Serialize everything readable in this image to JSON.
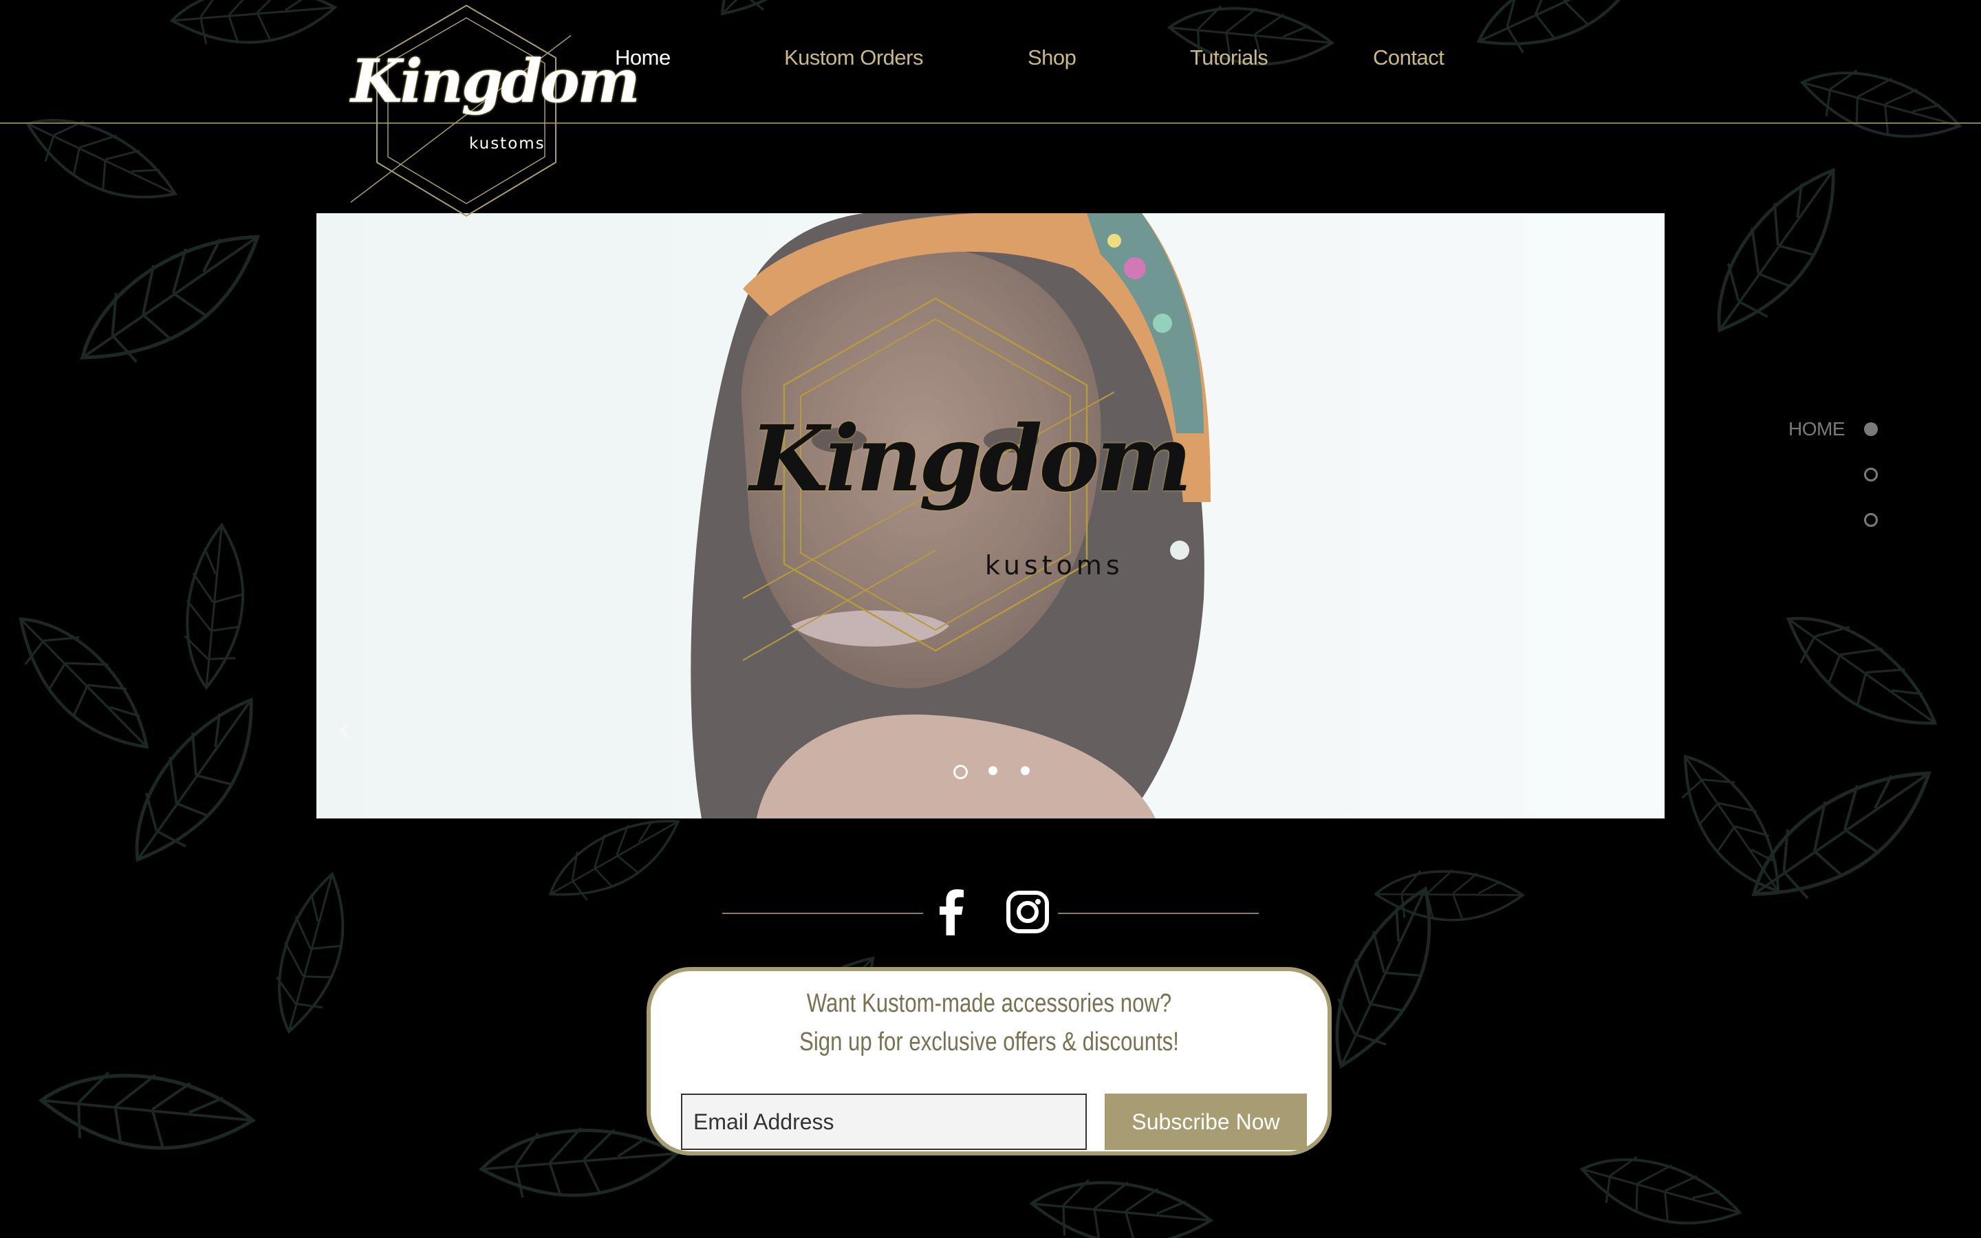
{
  "brand": {
    "name_script": "Kingdom",
    "name_sub": "kustoms",
    "accent_gold": "#a89d72",
    "background": "#000000"
  },
  "nav": {
    "items": [
      {
        "label": "Home",
        "active": true
      },
      {
        "label": "Kustom Orders",
        "active": false
      },
      {
        "label": "Shop",
        "active": false
      },
      {
        "label": "Tutorials",
        "active": false
      },
      {
        "label": "Contact",
        "active": false
      }
    ]
  },
  "slideshow": {
    "emblem_word": "Kingdom",
    "emblem_sub": "kustoms",
    "slide_count": 3,
    "current_slide": 1
  },
  "anchor_menu": {
    "label": "HOME",
    "dot_count": 3,
    "active_index": 1
  },
  "social": {
    "icons": [
      "facebook-icon",
      "instagram-icon"
    ]
  },
  "subscribe": {
    "line1": "Want Kustom-made accessories now?",
    "line2": "Sign up for exclusive offers & discounts!",
    "email_placeholder": "Email Address",
    "button_label": "Subscribe Now"
  }
}
